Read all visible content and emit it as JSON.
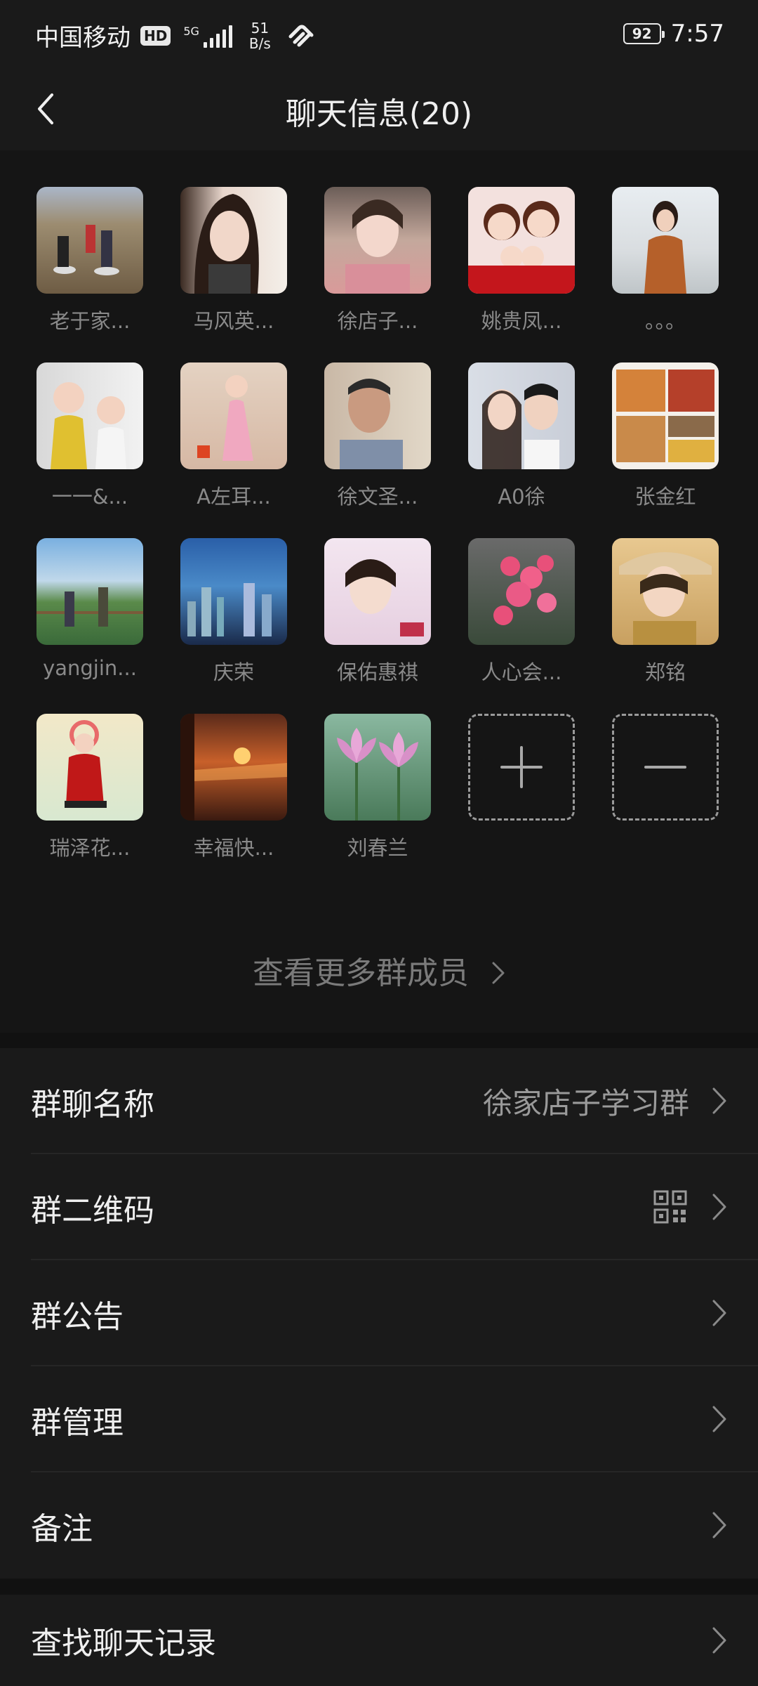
{
  "status_bar": {
    "carrier": "中国移动",
    "hd": "HD",
    "network": "5G",
    "speed_value": "51",
    "speed_unit": "B/s",
    "battery": "92",
    "time": "7:57"
  },
  "header": {
    "title": "聊天信息(20)",
    "back_icon": "chevron-left-icon"
  },
  "members": [
    {
      "name": "老于家..."
    },
    {
      "name": "马风英..."
    },
    {
      "name": "徐店子..."
    },
    {
      "name": "姚贵凤..."
    },
    {
      "name": "。。。"
    },
    {
      "name": "一一&..."
    },
    {
      "name": "A左耳..."
    },
    {
      "name": "徐文圣..."
    },
    {
      "name": "A0徐"
    },
    {
      "name": "张金红"
    },
    {
      "name": "yangjin..."
    },
    {
      "name": "庆荣"
    },
    {
      "name": "保佑惠祺"
    },
    {
      "name": "人心会..."
    },
    {
      "name": "郑铭"
    },
    {
      "name": "瑞泽花..."
    },
    {
      "name": "幸福快..."
    },
    {
      "name": "刘春兰"
    }
  ],
  "member_actions": {
    "add_icon": "plus-icon",
    "remove_icon": "minus-icon"
  },
  "more_members": {
    "label": "查看更多群成员"
  },
  "settings": {
    "group_name": {
      "label": "群聊名称",
      "value": "徐家店子学习群"
    },
    "qr_code": {
      "label": "群二维码",
      "icon": "qr-code-icon"
    },
    "announcement": {
      "label": "群公告"
    },
    "management": {
      "label": "群管理"
    },
    "remark": {
      "label": "备注"
    },
    "search_history": {
      "label": "查找聊天记录"
    }
  },
  "colors": {
    "background": "#111111",
    "surface": "#1a1a1a",
    "text_primary": "#efefef",
    "text_secondary": "#8a8a8a"
  }
}
